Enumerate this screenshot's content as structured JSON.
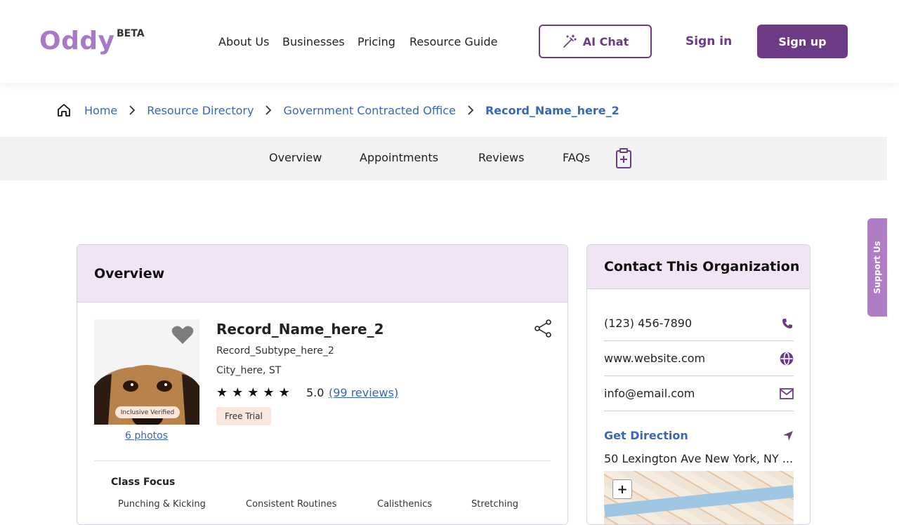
{
  "header": {
    "logo": "Oddy",
    "beta": "BETA",
    "nav": [
      "About Us",
      "Businesses",
      "Pricing",
      "Resource Guide"
    ],
    "ai_chat": "AI Chat",
    "sign_in": "Sign in",
    "sign_up": "Sign up"
  },
  "breadcrumb": {
    "items": [
      "Home",
      "Resource Directory",
      "Government Contracted Office"
    ],
    "current": "Record_Name_here_2"
  },
  "tabs": [
    "Overview",
    "Appointments",
    "Reviews",
    "FAQs"
  ],
  "overview": {
    "heading": "Overview",
    "name": "Record_Name_here_2",
    "subtype": "Record_Subtype_here_2",
    "city": "City_here, ST",
    "stars": 5,
    "rating": "5.0",
    "reviews": "(99 reviews)",
    "badge": "Free Trial",
    "verified": "Inclusive Verified",
    "photos": "6 photos",
    "class_focus_label": "Class Focus",
    "class_focus": [
      "Punching & Kicking",
      "Consistent Routines",
      "Calisthenics",
      "Stretching"
    ]
  },
  "contact": {
    "heading": "Contact This Organization",
    "phone": "(123) 456-7890",
    "website": "www.website.com",
    "email": "info@email.com",
    "get_direction": "Get Direction",
    "address": "50 Lexington Ave New York, NY ...",
    "zoom_in": "+"
  },
  "support": "Support Us",
  "colors": {
    "brand": "#6d3a86",
    "logo": "#a879c9",
    "link": "#3a66b8",
    "card_header": "#f1e5f5"
  }
}
